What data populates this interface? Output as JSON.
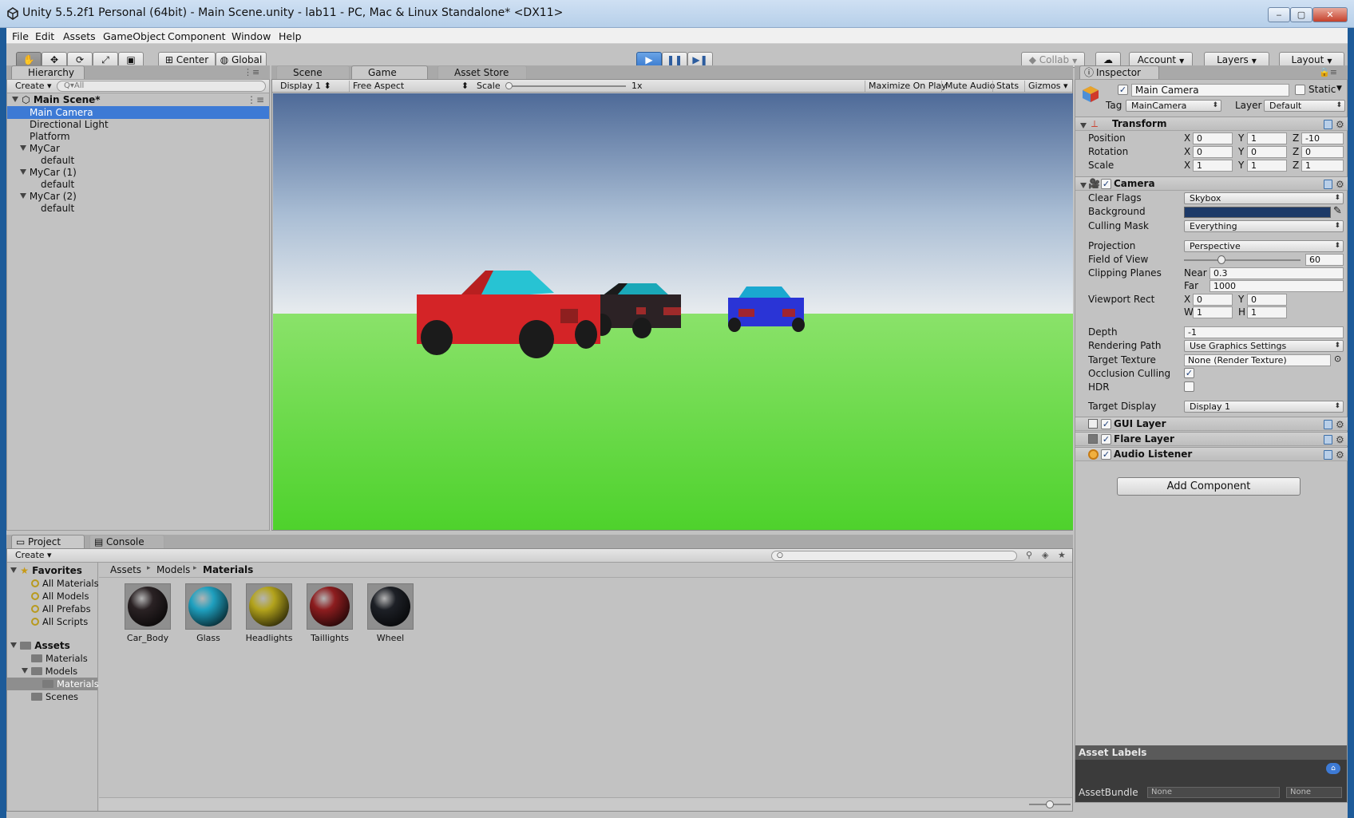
{
  "window": {
    "title": "Unity 5.5.2f1 Personal (64bit) - Main Scene.unity - lab11 - PC, Mac & Linux Standalone* <DX11>",
    "minimize": "‒",
    "maximize": "▢",
    "close": "✕"
  },
  "menu": [
    "File",
    "Edit",
    "Assets",
    "GameObject",
    "Component",
    "Window",
    "Help"
  ],
  "toolbar": {
    "pivot": "Center",
    "space": "Global",
    "collab": "Collab",
    "account": "Account",
    "layers": "Layers",
    "layout": "Layout"
  },
  "hierarchy": {
    "tab": "Hierarchy",
    "create": "Create",
    "search_placeholder": "Q▾All",
    "scene": "Main Scene*",
    "items": [
      "Main Camera",
      "Directional Light",
      "Platform",
      "MyCar",
      "default",
      "MyCar (1)",
      "default",
      "MyCar (2)",
      "default"
    ]
  },
  "viewTabs": {
    "scene": "Scene",
    "game": "Game",
    "store": "Asset Store"
  },
  "game": {
    "display": "Display 1",
    "aspect": "Free Aspect",
    "scale_label": "Scale",
    "scale_value": "1x",
    "maximize": "Maximize On Play",
    "mute": "Mute Audio",
    "stats": "Stats",
    "gizmos": "Gizmos"
  },
  "inspector": {
    "tab": "Inspector",
    "name": "Main Camera",
    "static": "Static",
    "tag_label": "Tag",
    "tag": "MainCamera",
    "layer_label": "Layer",
    "layer": "Default",
    "transform": {
      "title": "Transform",
      "position": "Position",
      "rotation": "Rotation",
      "scale": "Scale",
      "x": "X",
      "y": "Y",
      "z": "Z",
      "pos": [
        "0",
        "1",
        "-10"
      ],
      "rot": [
        "0",
        "0",
        "0"
      ],
      "scl": [
        "1",
        "1",
        "1"
      ]
    },
    "camera": {
      "title": "Camera",
      "clear_flags_label": "Clear Flags",
      "clear_flags": "Skybox",
      "background_label": "Background",
      "background_color": "#1d3a68",
      "culling_label": "Culling Mask",
      "culling": "Everything",
      "projection_label": "Projection",
      "projection": "Perspective",
      "fov_label": "Field of View",
      "fov": "60",
      "clipping_label": "Clipping Planes",
      "near_label": "Near",
      "near": "0.3",
      "far_label": "Far",
      "far": "1000",
      "viewport_label": "Viewport Rect",
      "vx": "0",
      "vy": "0",
      "vw": "1",
      "vh": "1",
      "w_label": "W",
      "h_label": "H",
      "depth_label": "Depth",
      "depth": "-1",
      "rendering_label": "Rendering Path",
      "rendering": "Use Graphics Settings",
      "target_tex_label": "Target Texture",
      "target_tex": "None (Render Texture)",
      "occlusion_label": "Occlusion Culling",
      "hdr_label": "HDR",
      "target_display_label": "Target Display",
      "target_display": "Display 1"
    },
    "gui_layer": "GUI Layer",
    "flare_layer": "Flare Layer",
    "audio_listener": "Audio Listener",
    "add_component": "Add Component",
    "asset_labels": "Asset Labels",
    "asset_bundle": "AssetBundle",
    "bundle1": "None",
    "bundle2": "None"
  },
  "project": {
    "tab": "Project",
    "console": "Console",
    "create": "Create",
    "breadcrumb": [
      "Assets",
      "Models",
      "Materials"
    ],
    "favorites": "Favorites",
    "fav_items": [
      "All Materials",
      "All Models",
      "All Prefabs",
      "All Scripts"
    ],
    "assets": "Assets",
    "folders": [
      "Materials",
      "Models",
      "Materials",
      "Scenes"
    ],
    "materials": [
      {
        "name": "Car_Body",
        "color": "#2a2224"
      },
      {
        "name": "Glass",
        "color": "#1fa0bf"
      },
      {
        "name": "Headlights",
        "color": "#b3a31c"
      },
      {
        "name": "Taillights",
        "color": "#8d1d1f"
      },
      {
        "name": "Wheel",
        "color": "#1d2026"
      }
    ]
  }
}
